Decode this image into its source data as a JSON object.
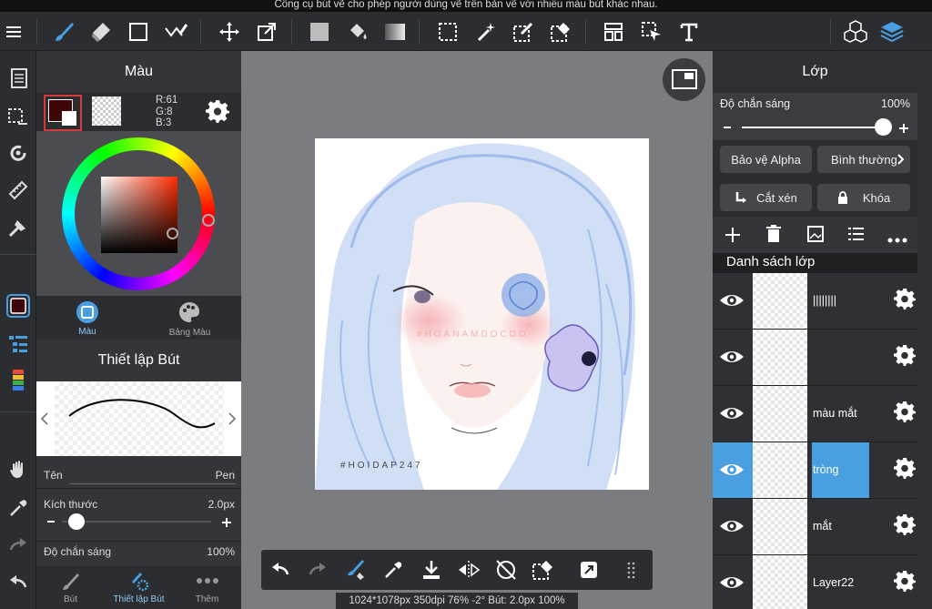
{
  "hint_text": "Công cụ bút vẽ cho phép người dùng vẽ trên bản vẽ với nhiều màu bút khác nhau.",
  "colors": {
    "accent": "#4a9fe0",
    "primary_color": "#3e0608",
    "secondary_color": "#ffffff"
  },
  "color_panel": {
    "title": "Màu",
    "r_label": "R:61",
    "g_label": "G:8",
    "b_label": "B:3",
    "tab_color": "Màu",
    "tab_palette": "Bảng Màu"
  },
  "brush_panel": {
    "title": "Thiết lập Bút",
    "name_label": "Tên",
    "name_value": "Pen",
    "size_label": "Kích thước",
    "size_value": "2.0px",
    "size_slider": 0.1,
    "opacity_label": "Độ chắn sáng",
    "opacity_value": "100%"
  },
  "bottom_tabs": {
    "brush": "Bút",
    "brush_settings": "Thiết lập Bút",
    "more": "Thêm"
  },
  "canvas": {
    "watermark_top": "#HOANAMDOCDO",
    "watermark_bottom": "#HOIDAP247"
  },
  "layer_panel": {
    "title": "Lớp",
    "opacity_label": "Độ chắn sáng",
    "opacity_value": "100%",
    "opacity_slider": 1.0,
    "alpha_protect": "Bảo vệ Alpha",
    "blend_mode": "Bình thường",
    "clipping": "Cắt xén",
    "lock": "Khóa",
    "list_title": "Danh sách lớp",
    "layers": [
      {
        "name": "||||||||",
        "selected": false
      },
      {
        "name": "",
        "selected": false
      },
      {
        "name": "màu mắt",
        "selected": false
      },
      {
        "name": "tròng",
        "selected": true
      },
      {
        "name": "mắt",
        "selected": false
      },
      {
        "name": "Layer22",
        "selected": false
      }
    ]
  },
  "status_bar": "1024*1078px 350dpi 76% -2° Bút: 2.0px 100%"
}
